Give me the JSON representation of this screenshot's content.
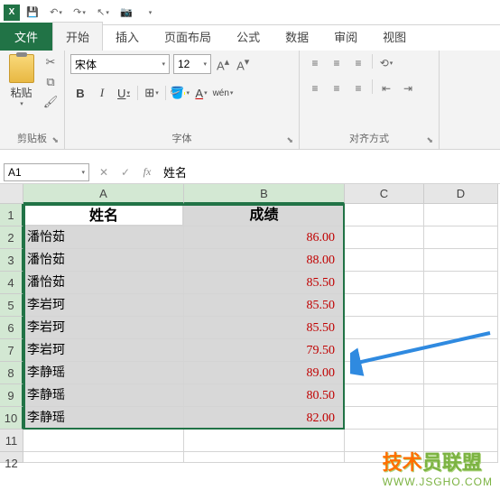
{
  "titlebar": {
    "app": "X"
  },
  "tabs": {
    "file": "文件",
    "home": "开始",
    "insert": "插入",
    "layout": "页面布局",
    "formulas": "公式",
    "data": "数据",
    "review": "审阅",
    "view": "视图"
  },
  "ribbon": {
    "clipboard": {
      "paste": "粘贴",
      "label": "剪贴板"
    },
    "font": {
      "name": "宋体",
      "size": "12",
      "label": "字体"
    },
    "align": {
      "label": "对齐方式"
    }
  },
  "formula_bar": {
    "name_box": "A1",
    "fx": "fx",
    "value": "姓名"
  },
  "columns": [
    "A",
    "B",
    "C",
    "D"
  ],
  "rows": [
    {
      "n": 1,
      "a": "姓名",
      "b": "成绩",
      "header": true
    },
    {
      "n": 2,
      "a": "潘怡茹",
      "b": "86.00"
    },
    {
      "n": 3,
      "a": "潘怡茹",
      "b": "88.00"
    },
    {
      "n": 4,
      "a": "潘怡茹",
      "b": "85.50"
    },
    {
      "n": 5,
      "a": "李岩珂",
      "b": "85.50"
    },
    {
      "n": 6,
      "a": "李岩珂",
      "b": "85.50"
    },
    {
      "n": 7,
      "a": "李岩珂",
      "b": "79.50"
    },
    {
      "n": 8,
      "a": "李静瑶",
      "b": "89.00"
    },
    {
      "n": 9,
      "a": "李静瑶",
      "b": "80.50"
    },
    {
      "n": 10,
      "a": "李静瑶",
      "b": "82.00"
    }
  ],
  "watermark": {
    "line1_a": "技术",
    "line1_b": "员联盟",
    "line2": "WWW.JSGHO.COM"
  }
}
